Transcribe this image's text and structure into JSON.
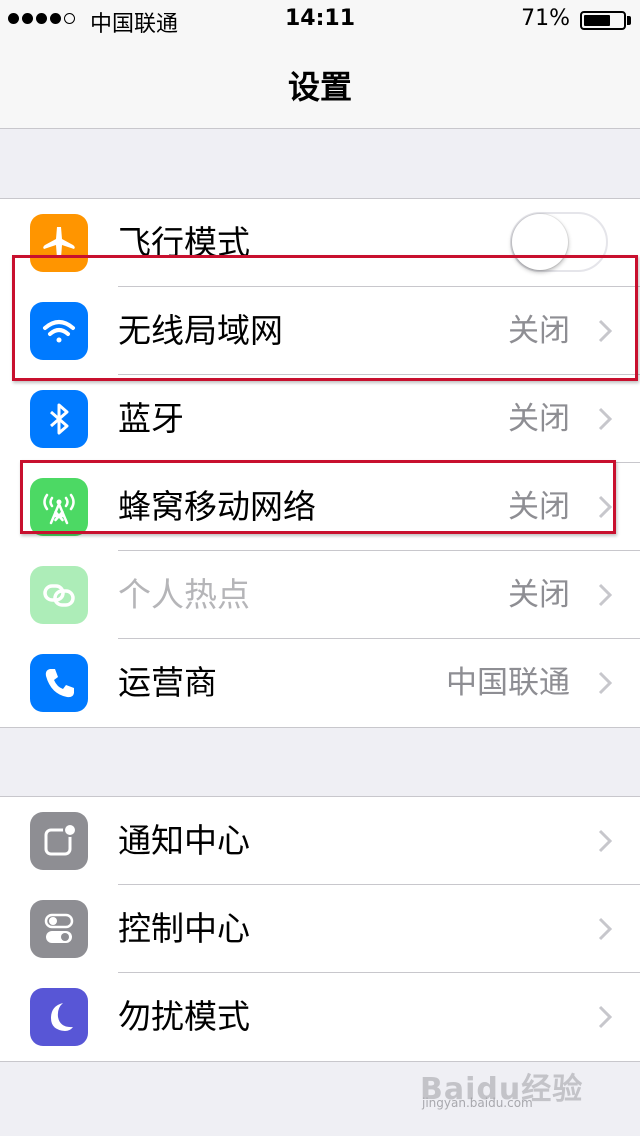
{
  "status_bar": {
    "carrier": "中国联通",
    "time": "14:11",
    "battery_percent": "71%",
    "battery_level": 0.71,
    "signal_bars_filled": 4,
    "signal_bars_total": 5
  },
  "nav": {
    "title": "设置"
  },
  "group1": [
    {
      "label": "飞行模式",
      "icon": "airplane-icon",
      "icon_color": "#ff9500",
      "control": "toggle",
      "toggle_on": false
    },
    {
      "label": "无线局域网",
      "icon": "wifi-icon",
      "icon_color": "#007aff",
      "value": "关闭",
      "highlighted": true
    },
    {
      "label": "蓝牙",
      "icon": "bluetooth-icon",
      "icon_color": "#007aff",
      "value": "关闭"
    },
    {
      "label": "蜂窝移动网络",
      "icon": "cellular-antenna-icon",
      "icon_color": "#4cd964",
      "value": "关闭",
      "highlighted": true
    },
    {
      "label": "个人热点",
      "icon": "hotspot-link-icon",
      "icon_color": "#4cd964",
      "value": "关闭",
      "disabled": true
    },
    {
      "label": "运营商",
      "icon": "phone-icon",
      "icon_color": "#007aff",
      "value": "中国联通"
    }
  ],
  "group2": [
    {
      "label": "通知中心",
      "icon": "notification-center-icon",
      "icon_color": "#8e8e93"
    },
    {
      "label": "控制中心",
      "icon": "control-center-icon",
      "icon_color": "#8e8e93"
    },
    {
      "label": "勿扰模式",
      "icon": "moon-icon",
      "icon_color": "#5856d6"
    }
  ],
  "watermark": {
    "text": "Baidu经验",
    "url": "jingyan.baidu.com"
  },
  "colors": {
    "highlight_border": "#c8102e",
    "background": "#efeff4",
    "secondary_text": "#8e8e93"
  }
}
